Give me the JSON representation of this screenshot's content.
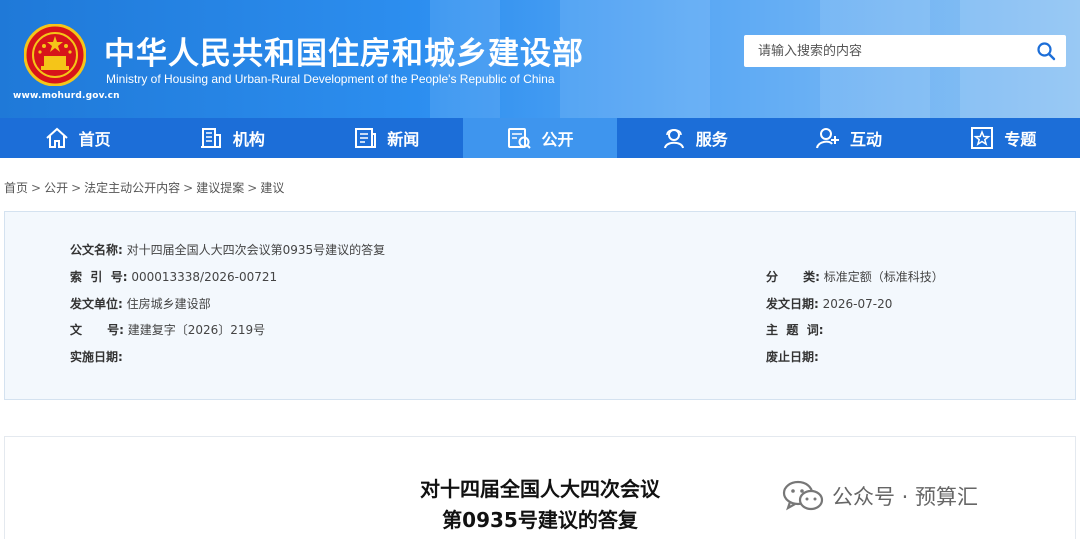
{
  "header": {
    "title_cn": "中华人民共和国住房和城乡建设部",
    "title_en": "Ministry of Housing and Urban-Rural Development of the People's Republic of China",
    "site_url": "www.mohurd.gov.cn",
    "search": {
      "placeholder": "请输入搜索的内容",
      "value": ""
    }
  },
  "nav": {
    "items": [
      {
        "label": "首页",
        "icon": "home-icon"
      },
      {
        "label": "机构",
        "icon": "building-icon"
      },
      {
        "label": "新闻",
        "icon": "newspaper-icon"
      },
      {
        "label": "公开",
        "icon": "disclosure-icon",
        "active": true
      },
      {
        "label": "服务",
        "icon": "service-icon"
      },
      {
        "label": "互动",
        "icon": "interaction-icon"
      },
      {
        "label": "专题",
        "icon": "topic-icon"
      }
    ]
  },
  "breadcrumb": [
    "首页",
    "公开",
    "法定主动公开内容",
    "建议提案",
    "建议"
  ],
  "info": {
    "doc_name_label": "公文名称:",
    "doc_name": "对十四届全国人大四次会议第0935号建议的答复",
    "index_label": "索  引  号:",
    "index": "000013338/2026-00721",
    "category_label": "分      类:",
    "category": "标准定额（标准科技）",
    "issuer_label": "发文单位:",
    "issuer": "住房城乡建设部",
    "date_label": "发文日期:",
    "date": "2026-07-20",
    "docno_label": "文      号:",
    "docno": "建建复字〔2026〕219号",
    "keywords_label": "主  题  词:",
    "keywords": "",
    "impl_date_label": "实施日期:",
    "impl_date": "",
    "expire_label": "废止日期:",
    "expire": ""
  },
  "document": {
    "title_line1": "对十四届全国人大四次会议",
    "title_line2": "第0935号建议的答复"
  },
  "watermark": {
    "text": "公众号 · 预算汇"
  },
  "colors": {
    "header_blue": "#2d8ff0",
    "nav_blue": "#1c6ed8",
    "nav_active": "#3e95ee",
    "panel_bg": "#f3f8fd"
  }
}
